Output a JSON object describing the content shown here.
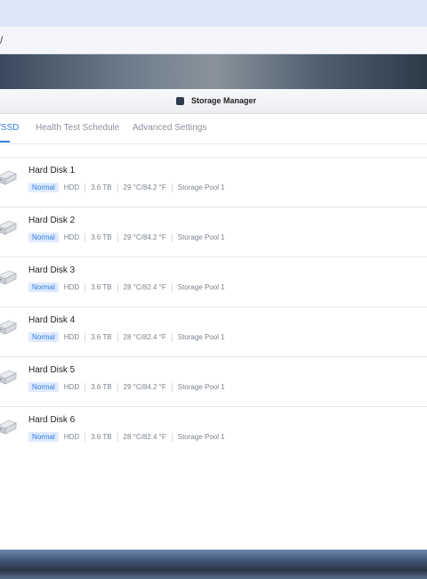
{
  "address": {
    "text": "/"
  },
  "window": {
    "title": "Storage Manager"
  },
  "tabs": [
    {
      "label": "/SSD",
      "active": true
    },
    {
      "label": "Health Test Schedule",
      "active": false
    },
    {
      "label": "Advanced Settings",
      "active": false
    }
  ],
  "disks": [
    {
      "name": "Hard Disk 1",
      "status": "Normal",
      "type": "HDD",
      "size": "3.6 TB",
      "temp": "29 °C/84.2 °F",
      "pool": "Storage Pool 1"
    },
    {
      "name": "Hard Disk 2",
      "status": "Normal",
      "type": "HDD",
      "size": "3.6 TB",
      "temp": "29 °C/84.2 °F",
      "pool": "Storage Pool 1"
    },
    {
      "name": "Hard Disk 3",
      "status": "Normal",
      "type": "HDD",
      "size": "3.6 TB",
      "temp": "28 °C/82.4 °F",
      "pool": "Storage Pool 1"
    },
    {
      "name": "Hard Disk 4",
      "status": "Normal",
      "type": "HDD",
      "size": "3.6 TB",
      "temp": "28 °C/82.4 °F",
      "pool": "Storage Pool 1"
    },
    {
      "name": "Hard Disk 5",
      "status": "Normal",
      "type": "HDD",
      "size": "3.6 TB",
      "temp": "29 °C/84.2 °F",
      "pool": "Storage Pool 1"
    },
    {
      "name": "Hard Disk 6",
      "status": "Normal",
      "type": "HDD",
      "size": "3.6 TB",
      "temp": "28 °C/82.4 °F",
      "pool": "Storage Pool 1"
    }
  ],
  "icons": {
    "disk": "hdd-icon",
    "app": "storage-manager-icon"
  },
  "colors": {
    "accent": "#2f7fe0",
    "badge_bg": "#dfeafe"
  }
}
